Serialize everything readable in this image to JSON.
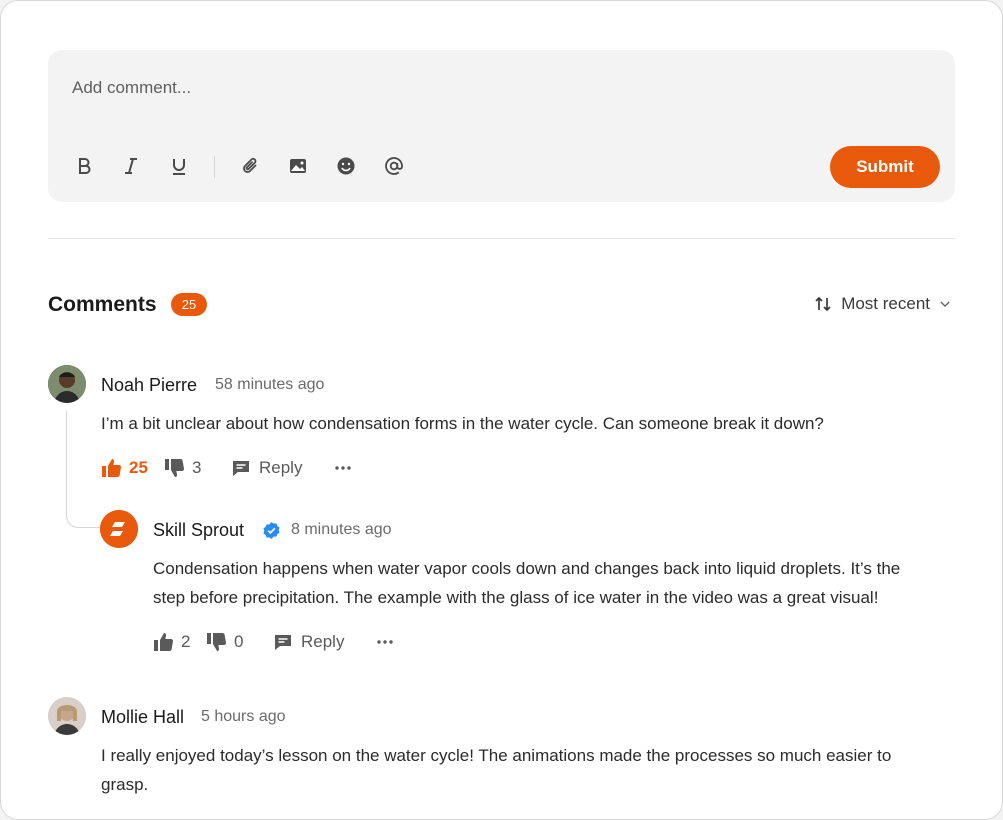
{
  "composer": {
    "placeholder": "Add comment...",
    "submit_label": "Submit"
  },
  "header": {
    "title": "Comments",
    "count": "25",
    "sort_label": "Most recent"
  },
  "comments": [
    {
      "author": "Noah Pierre",
      "time": "58 minutes ago",
      "text": "I’m a bit unclear about how condensation forms in the water cycle. Can someone break it down?",
      "likes": "25",
      "dislikes": "3",
      "reply_label": "Reply",
      "liked": true
    },
    {
      "author": "Skill Sprout",
      "verified": true,
      "time": "8 minutes ago",
      "text_line1": "Condensation happens when water vapor cools down and changes back into liquid droplets. It’s the",
      "text_line2": "step before precipitation. The example with the glass of ice water in the video was a great visual!",
      "likes": "2",
      "dislikes": "0",
      "reply_label": "Reply"
    },
    {
      "author": "Mollie Hall",
      "time": "5 hours ago",
      "text_line1": "I really enjoyed today’s lesson on the water cycle! The animations made the processes so much easier to",
      "text_line2": "grasp."
    }
  ],
  "colors": {
    "accent": "#e8590c",
    "verified": "#2a8cf0"
  },
  "icons": {
    "toolbar": [
      "bold-icon",
      "italic-icon",
      "underline-icon",
      "attachment-icon",
      "image-icon",
      "emoji-icon",
      "mention-icon"
    ],
    "sort": "sort-arrows-icon",
    "sort_chevron": "chevron-down-icon",
    "like": "thumbs-up-icon",
    "dislike": "thumbs-down-icon",
    "reply": "comment-icon",
    "more": "more-horizontal-icon"
  }
}
